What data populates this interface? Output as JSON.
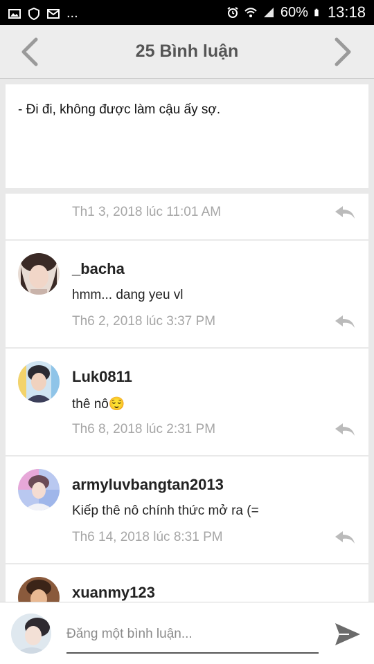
{
  "status_bar": {
    "battery": "60%",
    "time": "13:18",
    "more": "..."
  },
  "header": {
    "title": "25 Bình luận",
    "prev_icon": "chevron-left-icon",
    "next_icon": "chevron-right-icon"
  },
  "quote": {
    "text": "- Đi đi, không được làm cậu ấy sợ."
  },
  "partial_comment": {
    "timestamp": "Th1 3, 2018 lúc 11:01 AM"
  },
  "comments": [
    {
      "username": "_bacha",
      "text": "hmm... dang yeu vl",
      "timestamp": "Th6 2, 2018 lúc 3:37 PM"
    },
    {
      "username": "Luk0811",
      "text": "thê nô😌",
      "timestamp": "Th6 8, 2018 lúc 2:31 PM"
    },
    {
      "username": "armyluvbangtan2013",
      "text": "Kiếp thê nô chính thức mở ra (=",
      "timestamp": "Th6 14, 2018 lúc 8:31 PM"
    },
    {
      "username": "xuanmy123",
      "text": "",
      "timestamp": ""
    }
  ],
  "composer": {
    "placeholder": "Đăng một bình luận..."
  },
  "colors": {
    "header_bg": "#ededed",
    "page_bg": "#e9e9e9",
    "timestamp": "#a6a6a6",
    "title": "#555555"
  }
}
